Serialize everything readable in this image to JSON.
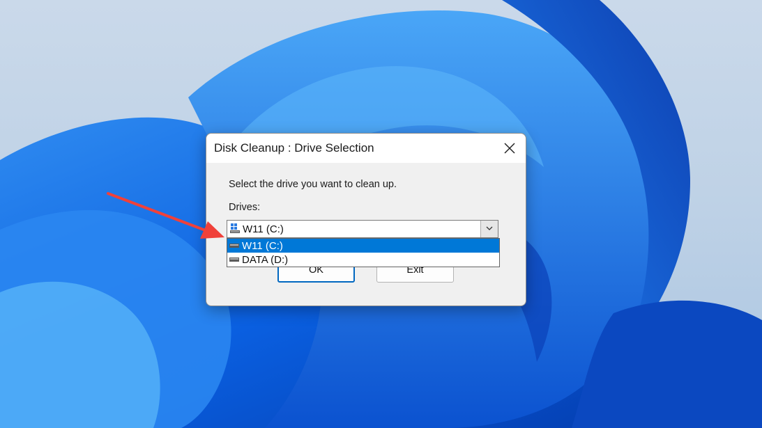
{
  "dialog": {
    "title": "Disk Cleanup : Drive Selection",
    "close_icon": "close-icon",
    "instruction": "Select the drive you want to clean up.",
    "drives_label": "Drives:",
    "combo": {
      "selected_value": "W11 (C:)",
      "icon": "windows-drive-icon",
      "arrow_icon": "chevron-down-icon"
    },
    "dropdown_options": [
      {
        "label": "W11 (C:)",
        "icon": "drive-icon",
        "selected": true
      },
      {
        "label": "DATA (D:)",
        "icon": "drive-icon",
        "selected": false
      }
    ],
    "ok_label": "OK",
    "exit_label": "Exit"
  },
  "annotation": {
    "icon": "red-arrow-icon",
    "color": "#f0413a"
  },
  "colors": {
    "selection": "#0078d7",
    "wallpaper_blue": "#1a6fe8",
    "ok_border": "#0067c0"
  }
}
